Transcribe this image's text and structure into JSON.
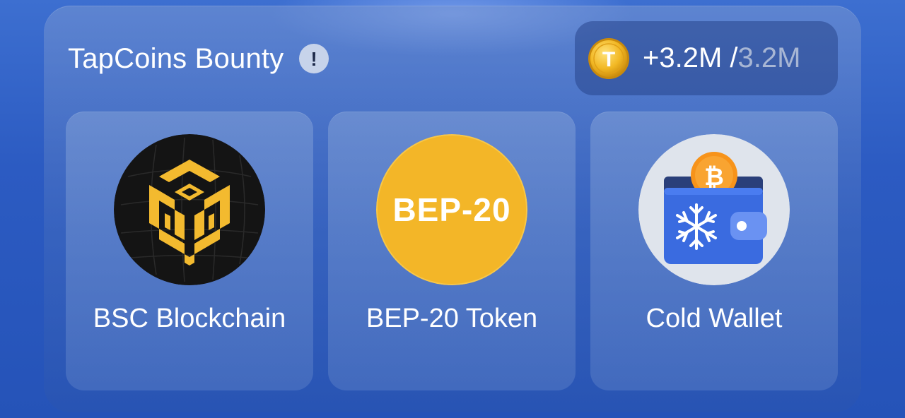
{
  "header": {
    "title": "TapCoins Bounty",
    "info_glyph": "!",
    "info_icon": "info-icon"
  },
  "reward": {
    "coin_icon": "tapcoin-icon",
    "coin_letter": "T",
    "earned": "+3.2M",
    "separator": " /",
    "total": "3.2M"
  },
  "cards": [
    {
      "label": "BSC Blockchain",
      "icon": "bnb-chain-icon"
    },
    {
      "label": "BEP-20 Token",
      "icon": "bep20-icon",
      "icon_text": "BEP-20"
    },
    {
      "label": "Cold Wallet",
      "icon": "cold-wallet-icon",
      "coin_glyph": "₿"
    }
  ],
  "colors": {
    "background": "#2c5bc2",
    "bnb_yellow": "#f3ba2f",
    "bep_yellow": "#f3b628",
    "wallet_blue": "#3a6be0",
    "bitcoin_orange": "#f7931a"
  }
}
